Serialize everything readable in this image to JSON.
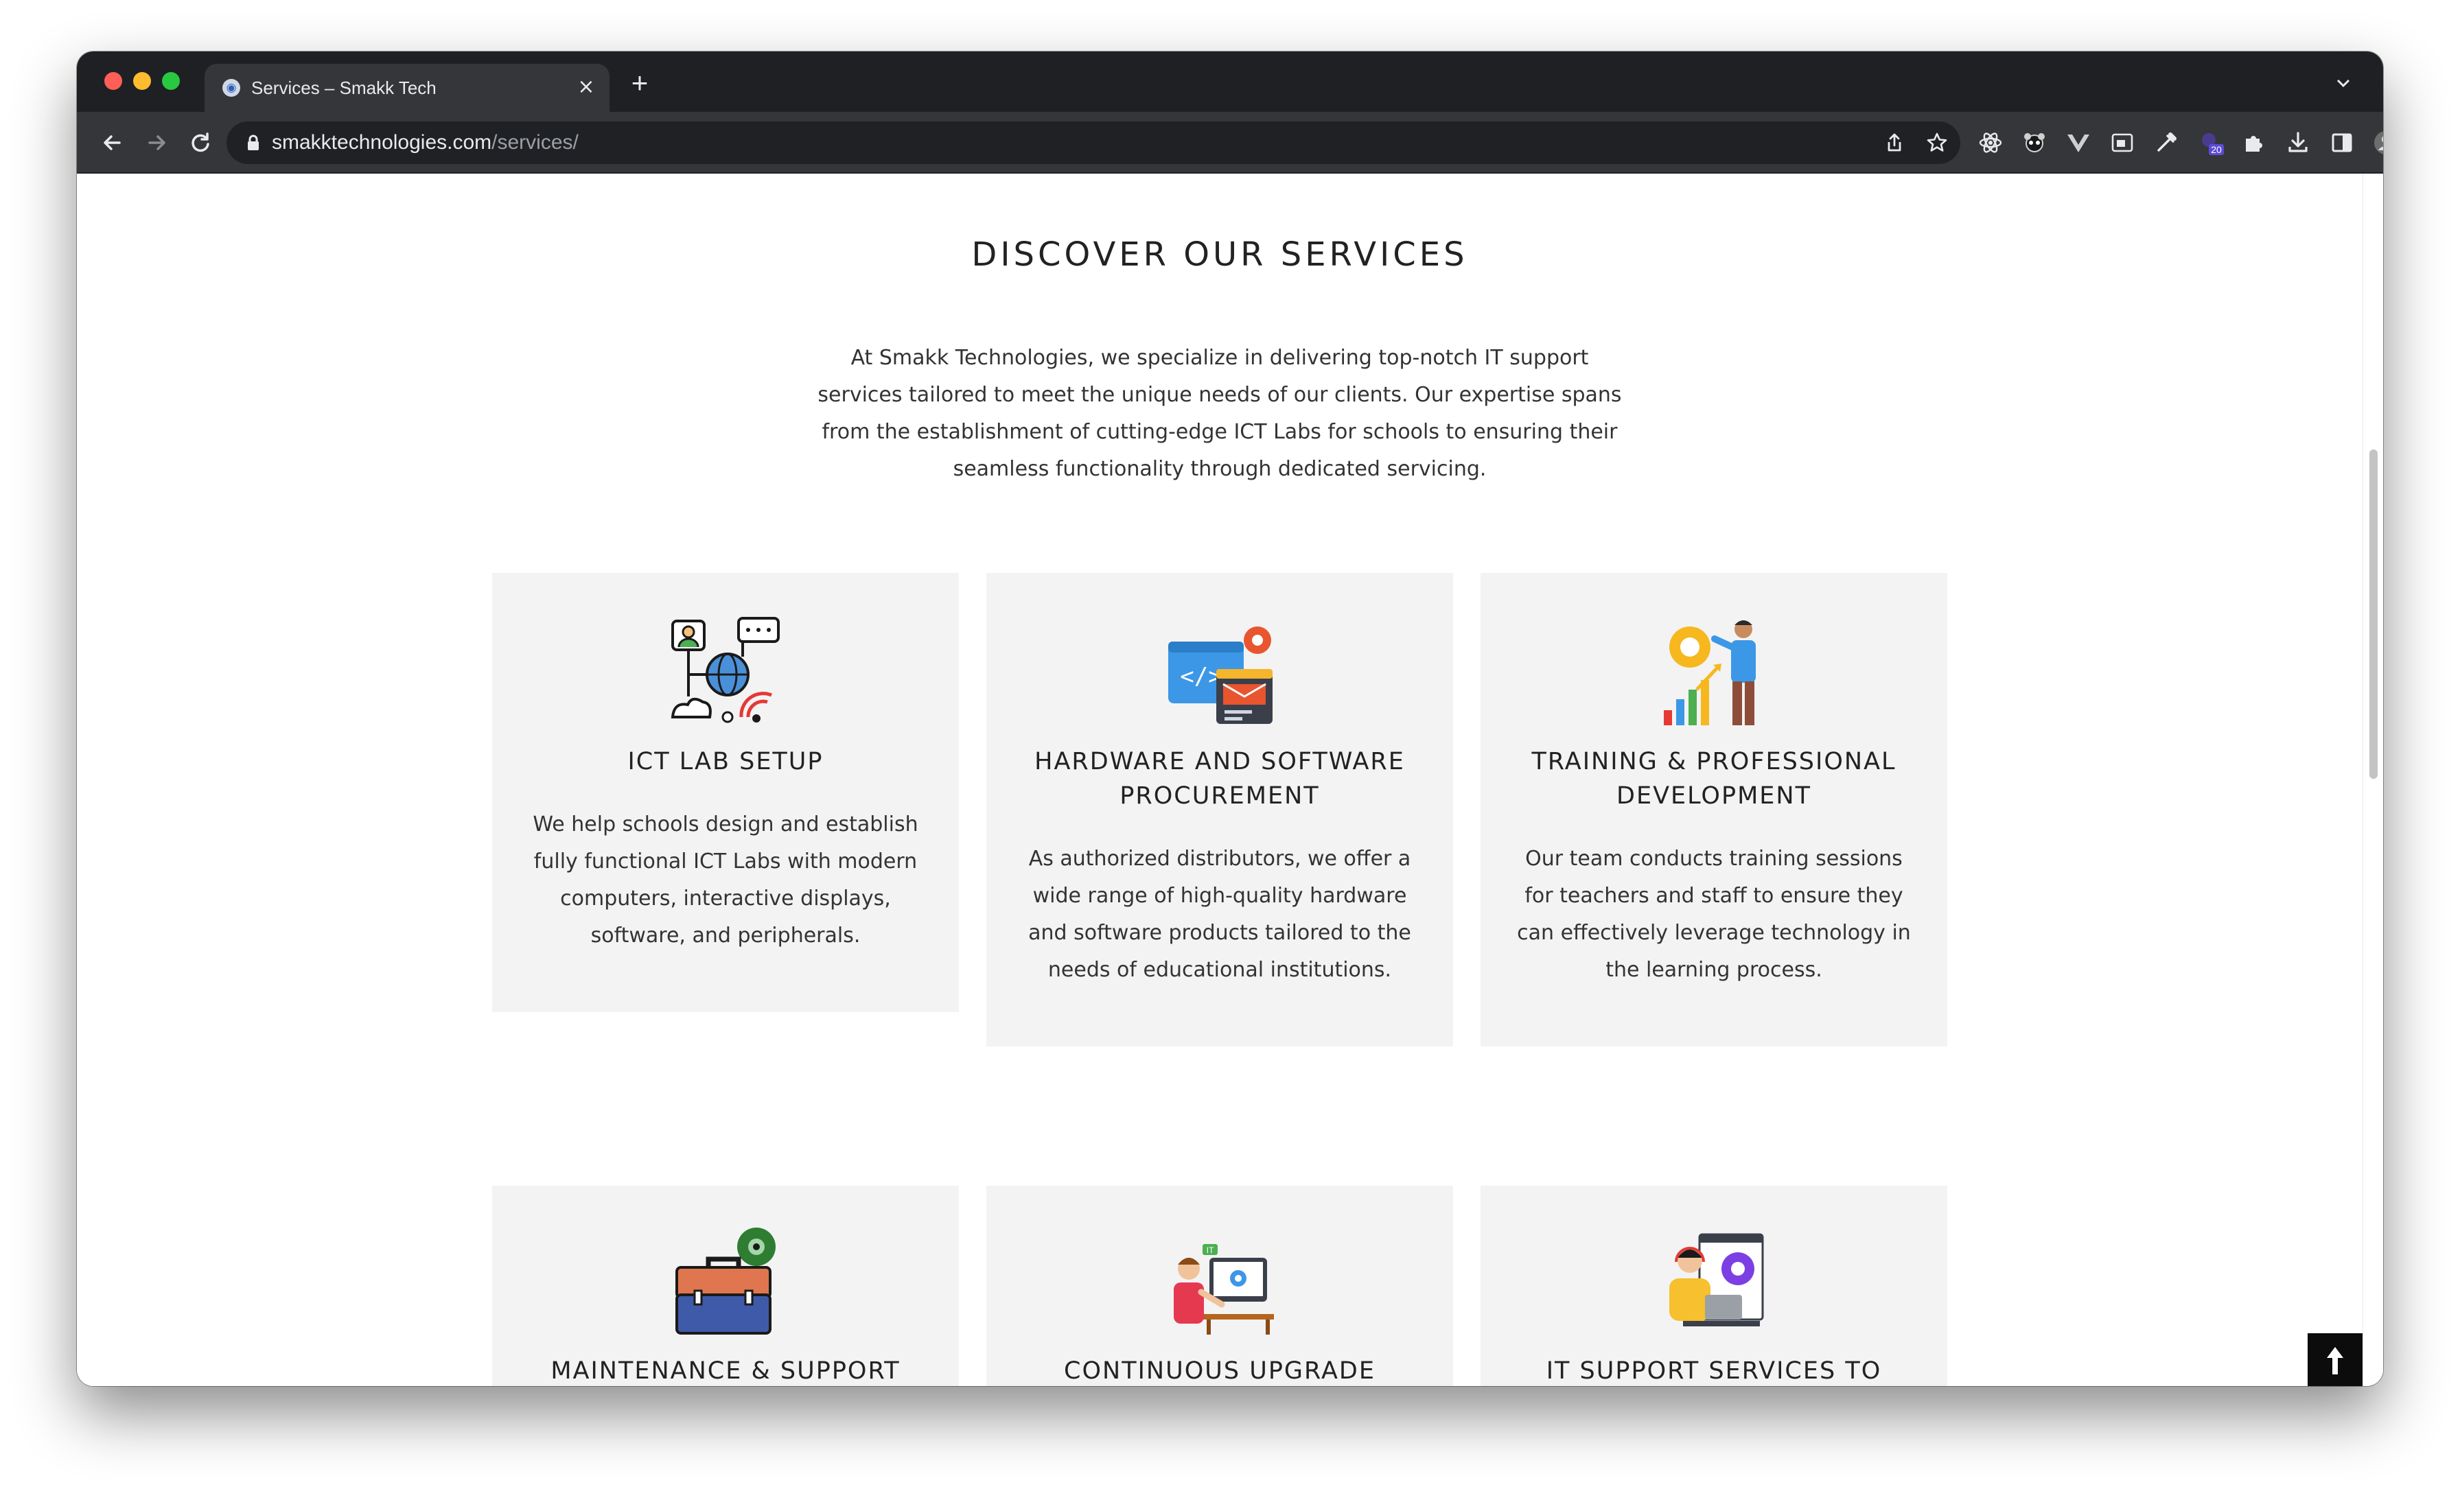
{
  "browser": {
    "tab_title": "Services – Smakk Tech",
    "tab_favicon": "globe-favicon",
    "url_host": "smakktechnologies.com",
    "url_path": "/services/",
    "extension_badge": "20"
  },
  "page": {
    "section_title": "DISCOVER OUR SERVICES",
    "intro": "At Smakk Technologies, we specialize in delivering top-notch IT support services tailored to meet the unique needs of our clients. Our expertise spans from the establishment of cutting-edge ICT Labs for schools to ensuring their seamless functionality through dedicated servicing.",
    "services": [
      {
        "title": "ICT LAB SETUP",
        "description": "We help schools design and establish fully functional ICT Labs with modern computers, interactive displays, software, and peripherals.",
        "icon": "network-globe-icon"
      },
      {
        "title": "HARDWARE AND SOFTWARE PROCUREMENT",
        "description": "As authorized distributors, we offer a wide range of high-quality hardware and software products tailored to the needs of educational institutions.",
        "icon": "code-window-gear-icon"
      },
      {
        "title": "TRAINING & PROFESSIONAL DEVELOPMENT",
        "description": "Our team conducts training sessions for teachers and staff to ensure they can effectively leverage technology in the learning process.",
        "icon": "presenter-growth-icon"
      },
      {
        "title": "MAINTENANCE & SUPPORT",
        "description": "",
        "icon": "toolbox-gear-icon"
      },
      {
        "title": "CONTINUOUS UPGRADE",
        "description": "",
        "icon": "it-technician-icon"
      },
      {
        "title": "IT SUPPORT SERVICES TO BUSINESSES",
        "description": "",
        "icon": "support-agent-icon"
      }
    ],
    "back_to_top_icon": "arrow-up-icon"
  },
  "colors": {
    "card_bg": "#f3f3f4",
    "chrome_dark": "#1f2023",
    "chrome_toolbar": "#35363a",
    "text": "#222222"
  }
}
